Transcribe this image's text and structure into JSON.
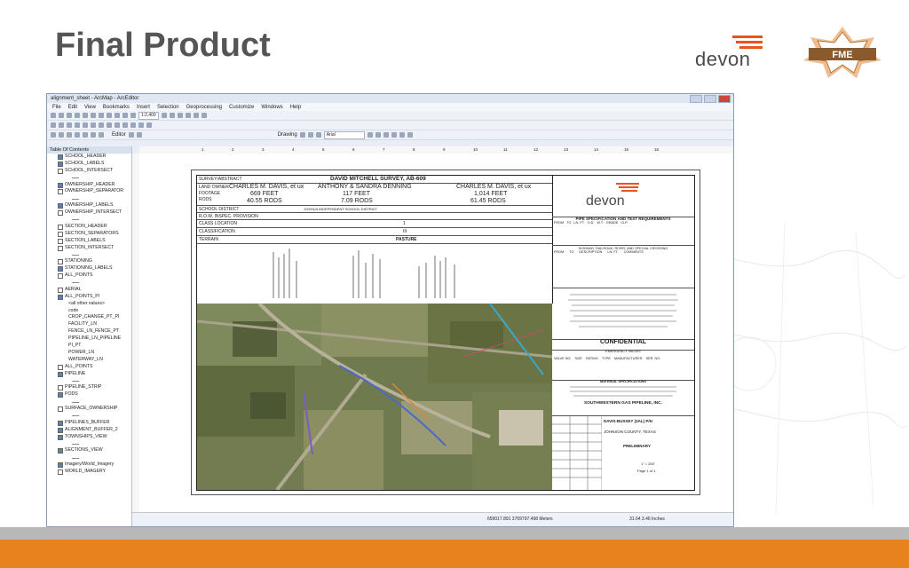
{
  "slide": {
    "title": "Final Product",
    "logo_devon": "devon",
    "logo_fme": "FME"
  },
  "app": {
    "title": "alignment_sheet - ArcMap - ArcEditor",
    "menus": [
      "File",
      "Edit",
      "View",
      "Bookmarks",
      "Insert",
      "Selection",
      "Geoprocessing",
      "Customize",
      "Windows",
      "Help"
    ],
    "scale": "1:2,400",
    "editor_label": "Editor",
    "drawing_label": "Drawing",
    "font_name": "Arial",
    "toc_title": "Table Of Contents",
    "toc_items": [
      {
        "label": "SCHOOL_HEADER",
        "checked": true
      },
      {
        "label": "SCHOOL_LABELS",
        "checked": true
      },
      {
        "label": "SCHOOL_INTERSECT",
        "checked": false
      },
      {
        "label": "",
        "checked": null
      },
      {
        "label": "OWNERSHIP_HEADER",
        "checked": true
      },
      {
        "label": "OWNERSHIP_SEPARATOR",
        "checked": false
      },
      {
        "label": "",
        "checked": null
      },
      {
        "label": "OWNERSHIP_LABELS",
        "checked": true
      },
      {
        "label": "OWNERSHIP_INTERSECT",
        "checked": false
      },
      {
        "label": "",
        "checked": null
      },
      {
        "label": "SECTION_HEADER",
        "checked": false
      },
      {
        "label": "SECTION_SEPARATORS",
        "checked": false
      },
      {
        "label": "SECTION_LABELS",
        "checked": false
      },
      {
        "label": "SECTION_INTERSECT",
        "checked": false
      },
      {
        "label": "",
        "checked": null
      },
      {
        "label": "STATIONING",
        "checked": false
      },
      {
        "label": "STATIONING_LABELS",
        "checked": true
      },
      {
        "label": "ALL_POINTS",
        "checked": false
      },
      {
        "label": "",
        "checked": null
      },
      {
        "label": "AERIAL",
        "checked": false
      },
      {
        "label": "ALL_POINTS_PI",
        "checked": true
      },
      {
        "label": "<all other values>",
        "checked": null
      },
      {
        "label": "code",
        "checked": null
      },
      {
        "label": "CROP_CHANGE_PT_PI",
        "checked": null
      },
      {
        "label": "FACILITY_LN",
        "checked": null
      },
      {
        "label": "FENCE_LN_FENCE_PT",
        "checked": null
      },
      {
        "label": "PIPELINE_LN_PIPELINE",
        "checked": null
      },
      {
        "label": "PI_PT",
        "checked": null
      },
      {
        "label": "POWER_LN",
        "checked": null
      },
      {
        "label": "WATERWAY_LN",
        "checked": null
      },
      {
        "label": "ALL_POINTS",
        "checked": false
      },
      {
        "label": "PIPELINE",
        "checked": true
      },
      {
        "label": "",
        "checked": null
      },
      {
        "label": "PIPELINE_STRIP",
        "checked": false
      },
      {
        "label": "PODS",
        "checked": true
      },
      {
        "label": "",
        "checked": null
      },
      {
        "label": "SURFACE_OWNERSHIP",
        "checked": false
      },
      {
        "label": "",
        "checked": null
      },
      {
        "label": "PIPELINES_BUFFER",
        "checked": true
      },
      {
        "label": "ALIGNMENT_BUFFER_2",
        "checked": true
      },
      {
        "label": "TOWNSHIPS_VIEW",
        "checked": true
      },
      {
        "label": "",
        "checked": null
      },
      {
        "label": "SECTIONS_VIEW",
        "checked": true
      },
      {
        "label": "",
        "checked": null
      },
      {
        "label": "Imagery/World_Imagery",
        "checked": true
      },
      {
        "label": "WORLD_IMAGERY",
        "checked": false
      }
    ],
    "ruler_ticks": [
      "1",
      "2",
      "3",
      "4",
      "5",
      "6",
      "7",
      "8",
      "9",
      "10",
      "11",
      "12",
      "13",
      "14",
      "15",
      "16"
    ],
    "status_coords": "659017.891  3769797.498 Meters",
    "status_page": "31.64  3.46 Inches"
  },
  "sheet": {
    "survey_abstract_label": "SURVEY/ABSTRACT",
    "survey_title": "DAVID MITCHELL SURVEY, AB-609",
    "land_owner_label": "LAND OWNER",
    "footage_label": "FOOTAGE",
    "rods_label": "RODS",
    "owner1": "CHARLES M. DAVIS, et ux",
    "owner1_feet": "669 FEET",
    "owner1_rods": "40.55 RODS",
    "owner2": "ANTHONY & SANDRA DENNING",
    "owner2_feet": "117 FEET",
    "owner2_rods": "7.09 RODS",
    "owner3": "CHARLES M. DAVIS, et ux",
    "owner3_feet": "1,014 FEET",
    "owner3_rods": "61.45 RODS",
    "school_district_label": "SCHOOL DISTRICT",
    "school_district": "JOSHUA INDEPENDENT SCHOOL DISTRICT",
    "row_label": "R.O.W. INSPEC. PROVISION",
    "class_location_label": "CLASS LOCATION",
    "class_location": "1",
    "classification_label": "CLASSIFICATION",
    "classification": "III",
    "terrain_label": "TERRAIN",
    "terrain": "PASTURE",
    "devon_logo": "devon",
    "pipe_spec_title": "PIPE SPECIFICATION AND TEST REQUIREMENTS",
    "pipe_spec_cols": [
      "FROM",
      "TO",
      "LN. FT.",
      "O.D.",
      "W.T.",
      "GRADE",
      "CLP."
    ],
    "highway_title": "HIGHWAY, RAILROAD, RIVER, AND SPECIAL CROSSING",
    "highway_cols": [
      "FROM",
      "TO",
      "DESCRIPTION",
      "LN. FT.",
      "COMMENTS"
    ],
    "confidential": "CONFIDENTIAL",
    "emergency_title": "EMERGENCY VALVES",
    "valve_cols": [
      "VALVE NO.",
      "SIZE",
      "RATING",
      "TYPE",
      "MANUFACTURER",
      "SER. NO."
    ],
    "material_title": "MATERIAL SPECIFICATIONS",
    "company": "SOUTHWESTERN GAS PIPELINE, INC.",
    "project": "DAVIS-BUSSEY (3AL) P/H",
    "county": "JOHNSON COUNTY, TEXAS",
    "status": "PRELIMINARY",
    "scale": "1\" = 200'",
    "page": "Page 1 of 1"
  }
}
